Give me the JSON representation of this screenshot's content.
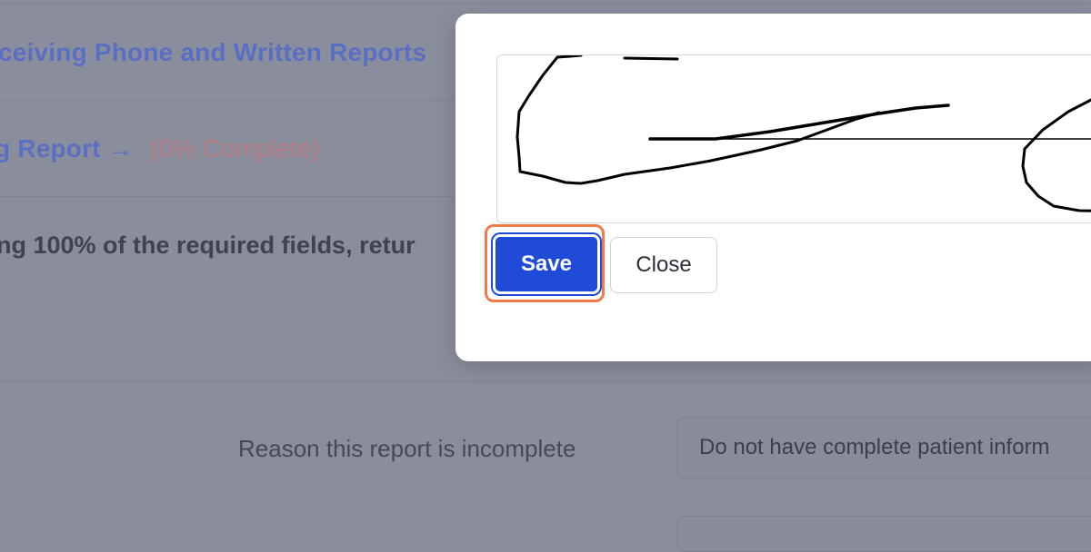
{
  "background": {
    "section1_link": "ceiving Phone and Written Reports",
    "section2_link": "g Report →",
    "section2_progress": "(0% Complete)",
    "instruction_text": "ng 100% of the required fields, retur",
    "incomplete_reason_label": "Reason this report is incomplete",
    "incomplete_reason_value": "Do not have complete patient inform"
  },
  "modal": {
    "save_label": "Save",
    "close_label": "Close"
  },
  "colors": {
    "overlay": "#8a8e9c",
    "primary_button": "#1f4bd8",
    "focus_ring": "#f07a4a",
    "link": "#5a6fc4",
    "progress_text": "#b57d83"
  }
}
